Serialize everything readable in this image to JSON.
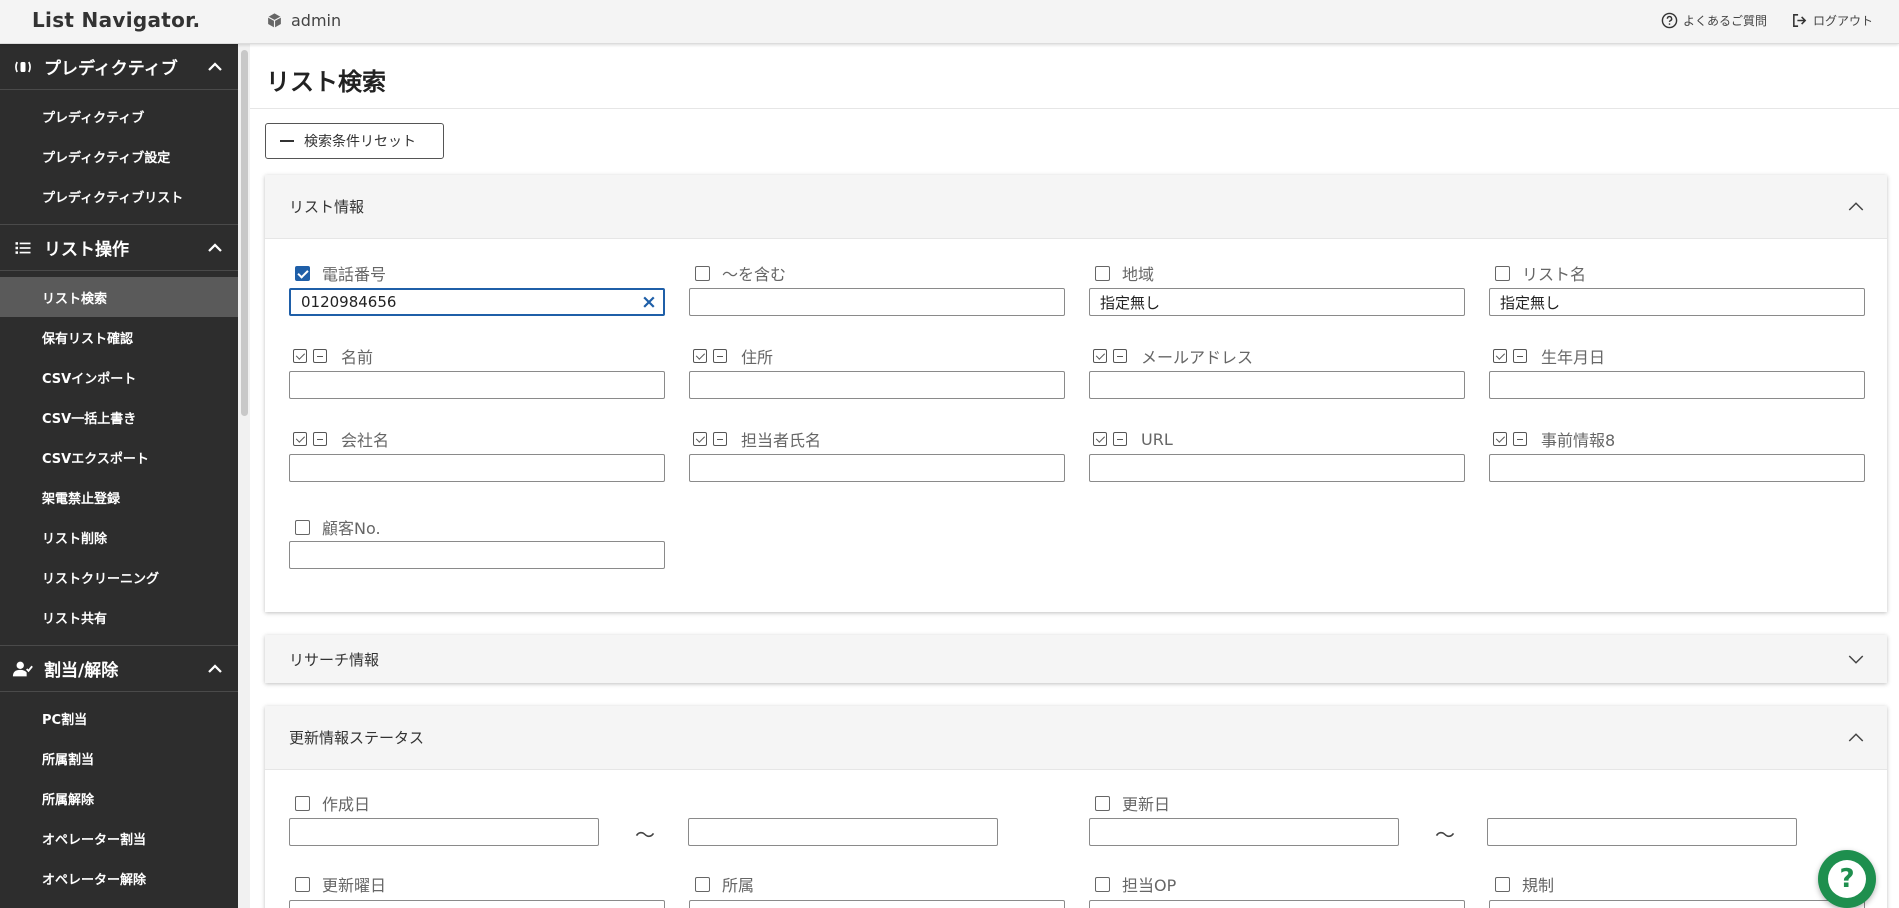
{
  "header": {
    "logo": "List Navigator.",
    "user": "admin",
    "faq": "よくあるご質問",
    "logout": "ログアウト"
  },
  "sidebar": {
    "sections": [
      {
        "title": "プレディクティブ",
        "icon": "phone-ring-icon",
        "items": [
          "プレディクティブ",
          "プレディクティブ設定",
          "プレディクティブリスト"
        ]
      },
      {
        "title": "リスト操作",
        "icon": "list-icon",
        "items": [
          "リスト検索",
          "保有リスト確認",
          "CSVインポート",
          "CSV一括上書き",
          "CSVエクスポート",
          "架電禁止登録",
          "リスト削除",
          "リストクリーニング",
          "リスト共有"
        ]
      },
      {
        "title": "割当/解除",
        "icon": "user-check-icon",
        "items": [
          "PC割当",
          "所属割当",
          "所属解除",
          "オペレーター割当",
          "オペレーター解除"
        ]
      }
    ],
    "active_item": "リスト検索"
  },
  "main": {
    "title": "リスト検索",
    "reset_button": "検索条件リセット",
    "list_info": {
      "title": "リスト情報",
      "fields": {
        "phone": {
          "label": "電話番号",
          "value": "0120984656",
          "checked": true
        },
        "contains": {
          "label": "～を含む",
          "value": "",
          "checked": false
        },
        "region": {
          "label": "地域",
          "value": "指定無し",
          "checked": false
        },
        "list_name": {
          "label": "リスト名",
          "value": "指定無し",
          "checked": false
        },
        "name": {
          "label": "名前",
          "value": ""
        },
        "address": {
          "label": "住所",
          "value": ""
        },
        "email": {
          "label": "メールアドレス",
          "value": ""
        },
        "birthday": {
          "label": "生年月日",
          "value": ""
        },
        "company": {
          "label": "会社名",
          "value": ""
        },
        "contact_name": {
          "label": "担当者氏名",
          "value": ""
        },
        "url": {
          "label": "URL",
          "value": ""
        },
        "prior_info8": {
          "label": "事前情報8",
          "value": ""
        },
        "customer_no": {
          "label": "顧客No.",
          "value": "",
          "checked": false
        }
      }
    },
    "research_info": {
      "title": "リサーチ情報"
    },
    "update_status": {
      "title": "更新情報ステータス",
      "tilde": "～",
      "fields": {
        "created": {
          "label": "作成日"
        },
        "updated": {
          "label": "更新日"
        },
        "update_weekday": {
          "label": "更新曜日"
        },
        "affiliation": {
          "label": "所属"
        },
        "assigned_op": {
          "label": "担当OP"
        },
        "regulation": {
          "label": "規制"
        }
      }
    }
  },
  "help_button": "?"
}
